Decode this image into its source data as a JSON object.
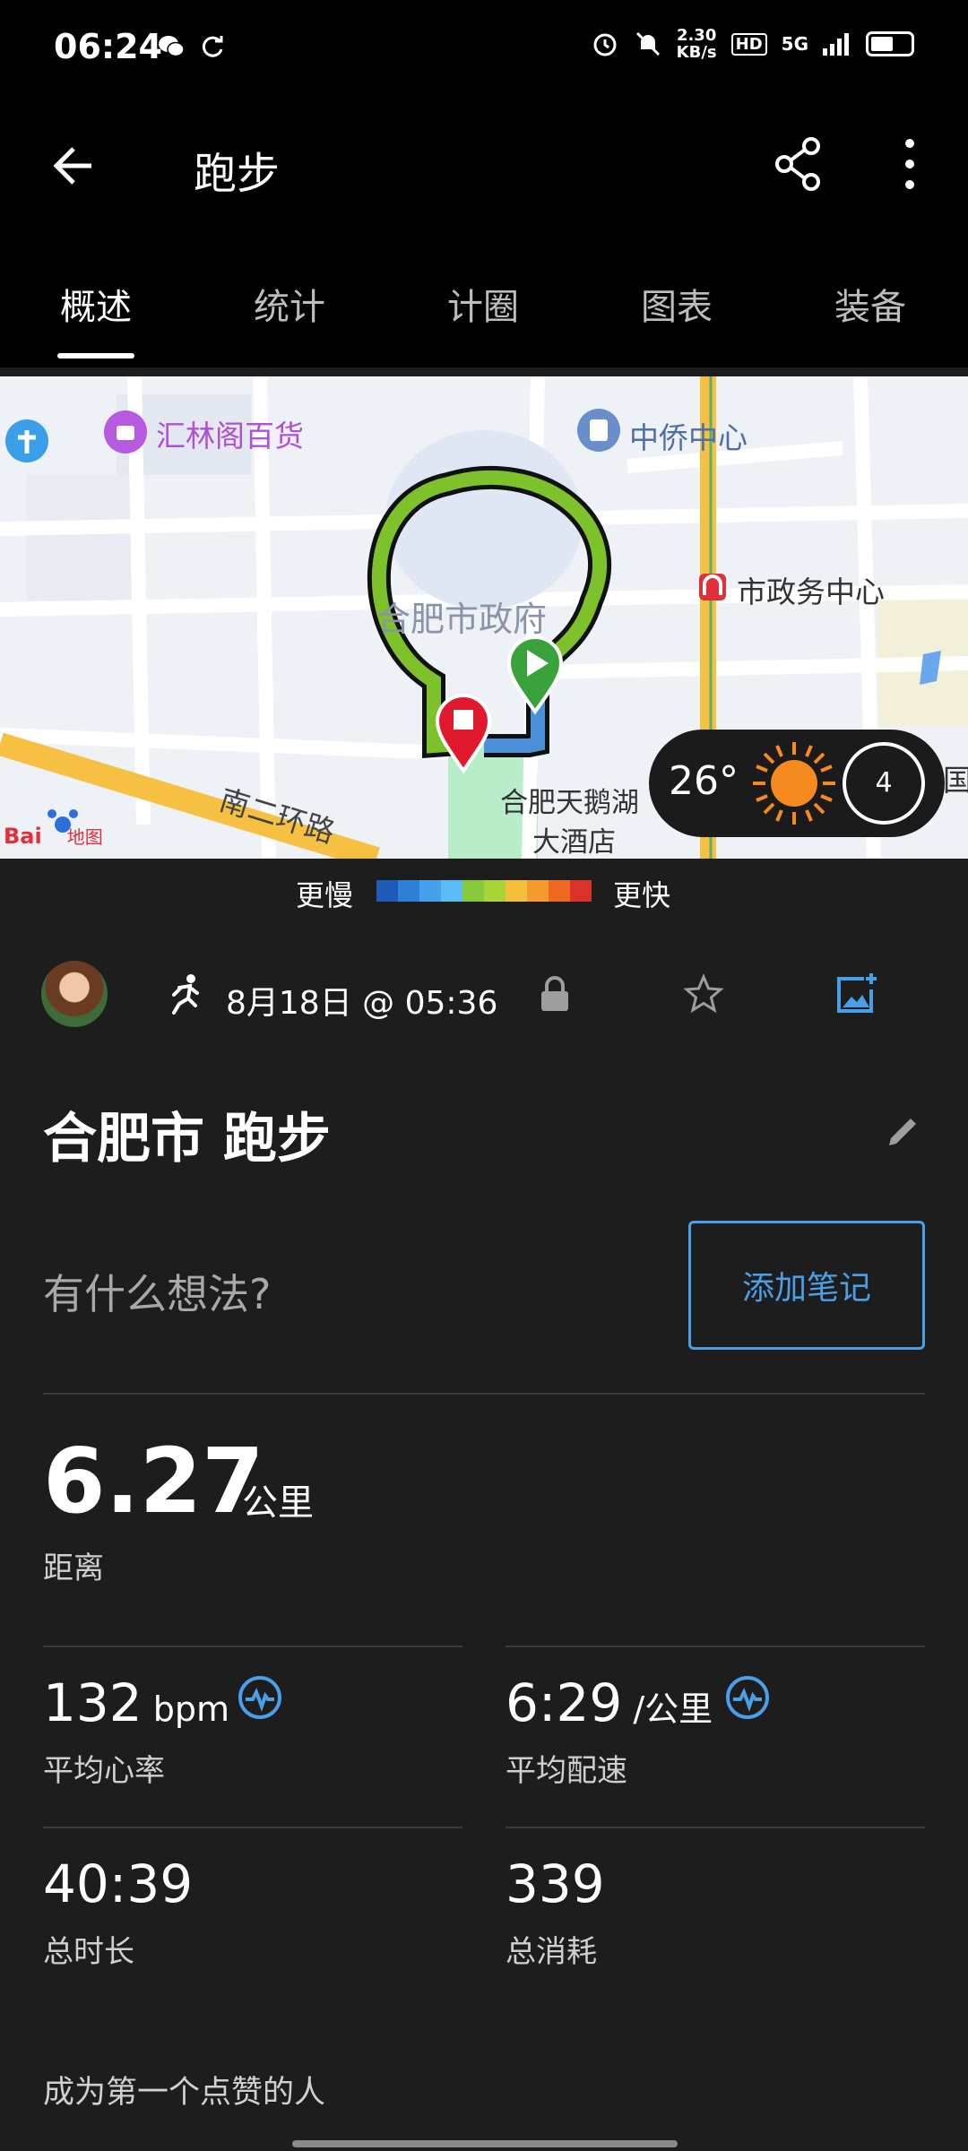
{
  "status_bar": {
    "time": "06:24",
    "speed_value": "2.30",
    "speed_unit": "KB/s",
    "hd": "HD",
    "network": "5G"
  },
  "app_bar": {
    "title": "跑步"
  },
  "tabs": [
    {
      "label": "概述",
      "active": true
    },
    {
      "label": "统计",
      "active": false
    },
    {
      "label": "计圈",
      "active": false
    },
    {
      "label": "图表",
      "active": false
    },
    {
      "label": "装备",
      "active": false
    }
  ],
  "map": {
    "labels": {
      "mall": "汇林阁百货",
      "center": "中侨中心",
      "govt_center": "市政务中心",
      "city_govt": "合肥市政府",
      "hotel_line1": "合肥天鹅湖",
      "hotel_line2": "大酒店",
      "road": "南二环路",
      "partial": "国",
      "logo_text": "Bai",
      "logo_suffix": "地图"
    },
    "weather": {
      "temp": "26°",
      "number": "4"
    }
  },
  "legend": {
    "slow": "更慢",
    "fast": "更快",
    "colors": [
      "#1e5bb8",
      "#2f7fd8",
      "#46a0ec",
      "#5bbcf3",
      "#86c93a",
      "#a8d43a",
      "#f3c03a",
      "#f59a2e",
      "#ee6a22",
      "#d8322a"
    ]
  },
  "activity": {
    "date": "8月18日 @ 05:36",
    "title": "合肥市 跑步",
    "notes_prompt": "有什么想法?",
    "add_note": "添加笔记"
  },
  "stats": {
    "distance": {
      "value": "6.27",
      "unit": "公里",
      "label": "距离"
    },
    "heart_rate": {
      "value": "132",
      "unit": " bpm",
      "label": "平均心率"
    },
    "pace": {
      "value": "6:29",
      "unit": " /公里",
      "label": "平均配速"
    },
    "duration": {
      "value": "40:39",
      "label": "总时长"
    },
    "calories": {
      "value": "339",
      "label": "总消耗"
    }
  },
  "social": {
    "like_prompt": "成为第一个点赞的人"
  },
  "colors": {
    "accent": "#4a9fe8",
    "route_green": "#7dc22a",
    "start_marker": "#3aa23a",
    "stop_marker": "#e0192f",
    "background": "#1d1d1d"
  }
}
